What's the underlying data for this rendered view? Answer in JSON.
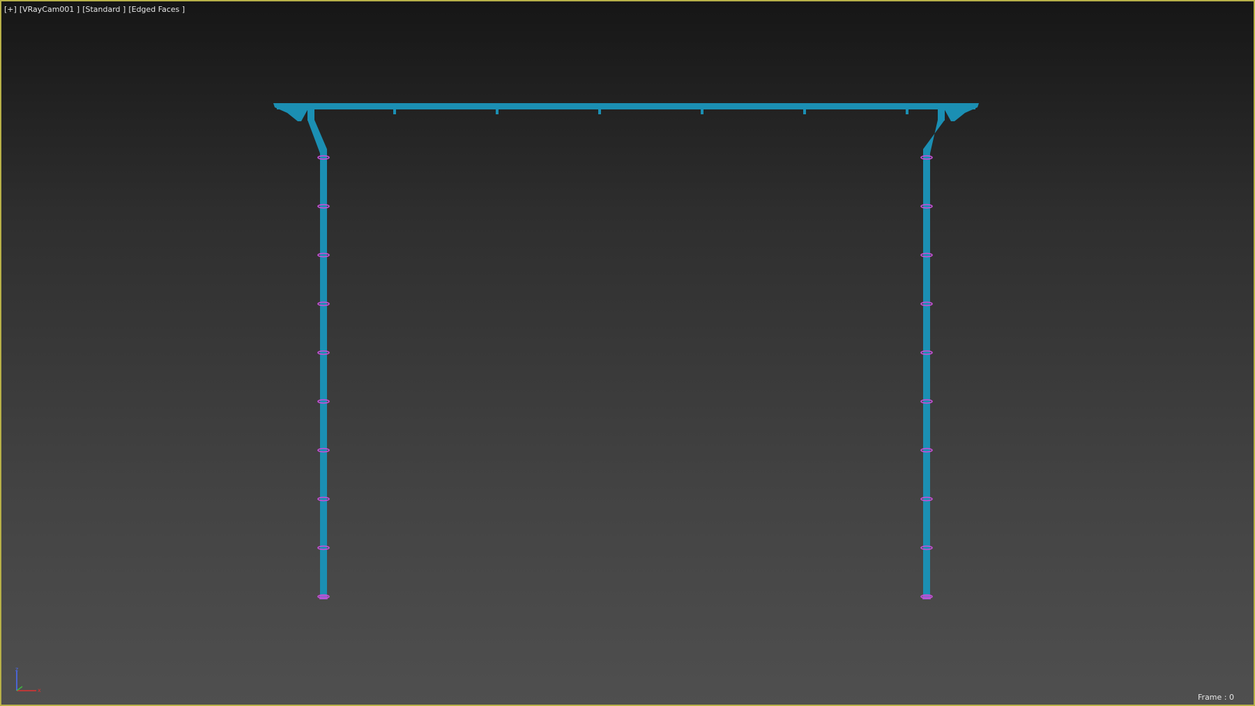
{
  "viewport": {
    "menu_plus": "[+]",
    "camera": "[VRayCam001 ]",
    "shading": "[Standard ]",
    "display_mode": "[Edged Faces ]",
    "frame_label": "Frame : 0",
    "border_color": "#b7b048"
  },
  "axis_gizmo": {
    "z_label": "z",
    "x_label": "x",
    "z_color": "#4a6cff",
    "x_color": "#e03030"
  },
  "scene": {
    "object_color": "#1b8fb3",
    "clip_color": "#c44fd6",
    "pipe_ring_count": 10,
    "gutter_bracket_count": 6
  }
}
